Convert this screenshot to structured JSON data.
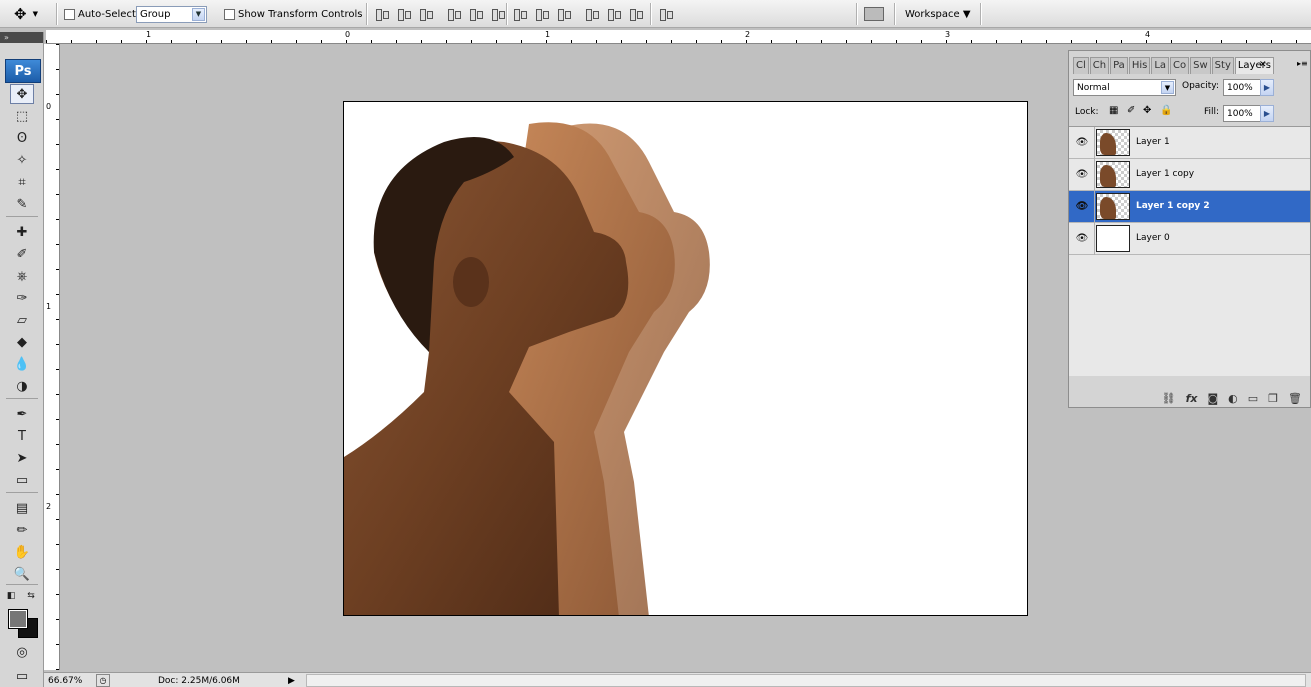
{
  "options_bar": {
    "auto_select_label": "Auto-Select:",
    "auto_select_value": "Group",
    "show_transform_label": "Show Transform Controls",
    "workspace_label": "Workspace ▼"
  },
  "toolbox": {
    "logo": "Ps",
    "tools": [
      "move-icon",
      "marquee-icon",
      "lasso-icon",
      "magic-wand-icon",
      "crop-icon",
      "slice-icon",
      "healing-brush-icon",
      "brush-icon",
      "clone-stamp-icon",
      "history-brush-icon",
      "eraser-icon",
      "paint-bucket-icon",
      "blur-icon",
      "dodge-icon",
      "pen-icon",
      "type-icon",
      "path-selection-icon",
      "shape-icon",
      "notes-icon",
      "eyedropper-icon",
      "hand-icon",
      "zoom-icon"
    ],
    "tool_glyphs": [
      "✥",
      "⬚",
      "ʘ",
      "✧",
      "⌗",
      "✎",
      "✚",
      "✐",
      "⎈",
      "✑",
      "▱",
      "◆",
      "💧",
      "◑",
      "✒",
      "T",
      "➤",
      "▭",
      "▤",
      "✏",
      "✋",
      "🔍"
    ],
    "foreground_color": "#777777",
    "background_color": "#111111"
  },
  "rulers": {
    "horizontal_labels": [
      "1",
      "0",
      "1",
      "2",
      "3",
      "4"
    ],
    "vertical_labels": [
      "0",
      "1",
      "2"
    ]
  },
  "status_bar": {
    "zoom": "66.67%",
    "doc_info": "Doc: 2.25M/6.06M"
  },
  "layers_panel": {
    "tabs": [
      "Cl",
      "Ch",
      "Pa",
      "His",
      "La",
      "Co",
      "Sw",
      "Sty",
      "Layers"
    ],
    "active_tab": "Layers",
    "blend_mode": "Normal",
    "opacity_label": "Opacity:",
    "opacity_value": "100%",
    "lock_label": "Lock:",
    "fill_label": "Fill:",
    "fill_value": "100%",
    "layers": [
      {
        "name": "Layer 1",
        "selected": false
      },
      {
        "name": "Layer 1 copy",
        "selected": false
      },
      {
        "name": "Layer 1 copy 2",
        "selected": true
      },
      {
        "name": "Layer 0",
        "selected": false
      }
    ]
  },
  "colors": {
    "selection": "#3169c6",
    "skin": "#7a4a2a"
  }
}
